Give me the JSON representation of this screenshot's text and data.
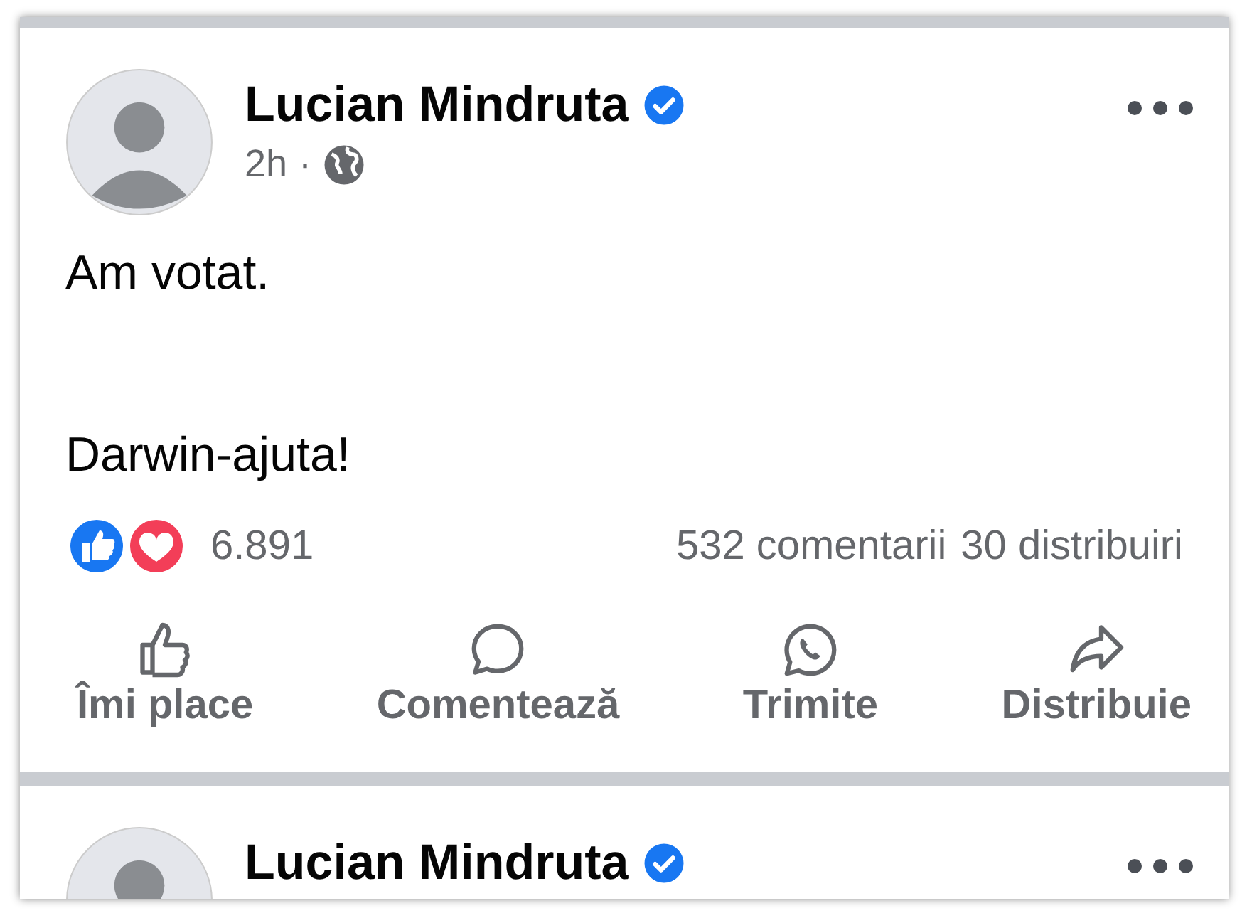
{
  "posts": [
    {
      "author": "Lucian Mindruta",
      "verified": true,
      "time": "2h",
      "separator": "·",
      "paragraphs": [
        "Am votat.",
        "Darwin-ajuta!"
      ],
      "reaction_count": "6.891",
      "comments": "532 comentarii",
      "shares": "30 distribuiri",
      "actions": [
        {
          "kind": "like",
          "label": "Îmi place"
        },
        {
          "kind": "comment",
          "label": "Comentează"
        },
        {
          "kind": "send",
          "label": "Trimite"
        },
        {
          "kind": "share",
          "label": "Distribuie"
        }
      ]
    },
    {
      "author": "Lucian Mindruta",
      "verified": true
    }
  ]
}
